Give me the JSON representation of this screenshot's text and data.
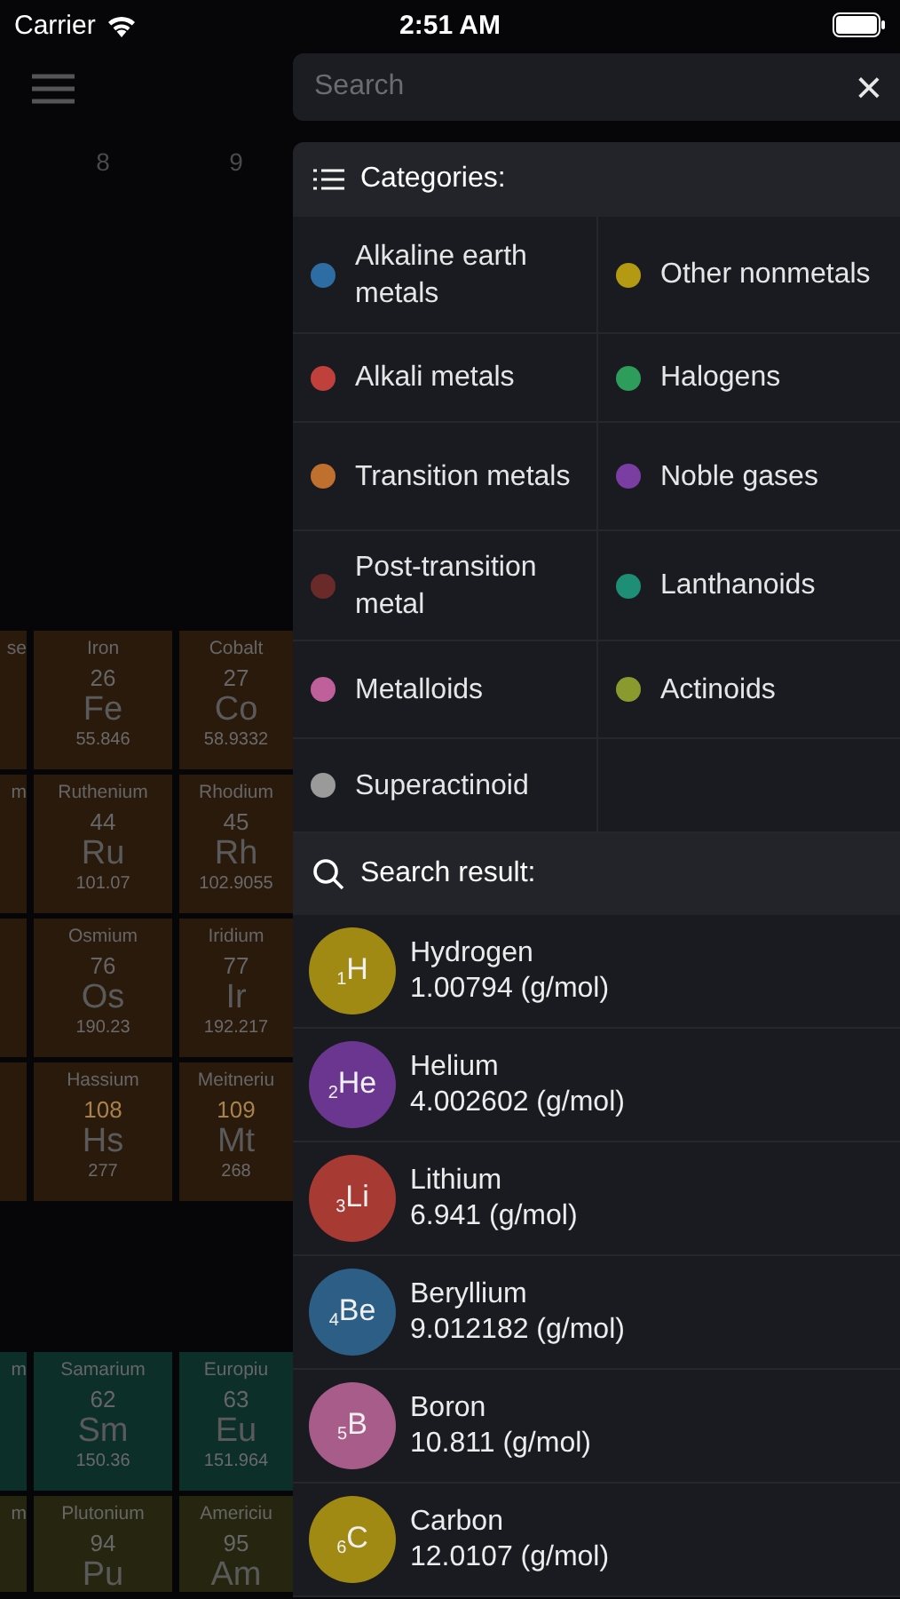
{
  "status_bar": {
    "carrier": "Carrier",
    "time": "2:51 AM"
  },
  "table": {
    "group_numbers": [
      "8",
      "9"
    ],
    "blocks": [
      {
        "rows": [
          [
            {
              "name": "se",
              "color": "#2a1a0c"
            },
            {
              "name": "Iron",
              "number": "26",
              "symbol": "Fe",
              "weight": "55.846",
              "synthetic": false,
              "color": "#2a1a0c"
            },
            {
              "name": "Cobalt",
              "number": "27",
              "symbol": "Co",
              "weight": "58.9332",
              "synthetic": false,
              "color": "#2a1a0c"
            }
          ],
          [
            {
              "name": "m",
              "color": "#2a1a0c"
            },
            {
              "name": "Ruthenium",
              "number": "44",
              "symbol": "Ru",
              "weight": "101.07",
              "synthetic": false,
              "color": "#2a1a0c"
            },
            {
              "name": "Rhodium",
              "number": "45",
              "symbol": "Rh",
              "weight": "102.9055",
              "synthetic": false,
              "color": "#2a1a0c"
            }
          ],
          [
            {
              "color": "#2a1a0c"
            },
            {
              "name": "Osmium",
              "number": "76",
              "symbol": "Os",
              "weight": "190.23",
              "synthetic": false,
              "color": "#2a1a0c"
            },
            {
              "name": "Iridium",
              "number": "77",
              "symbol": "Ir",
              "weight": "192.217",
              "synthetic": false,
              "color": "#2a1a0c"
            }
          ],
          [
            {
              "color": "#2a1a0c"
            },
            {
              "name": "Hassium",
              "number": "108",
              "symbol": "Hs",
              "weight": "277",
              "synthetic": true,
              "color": "#2a1a0c"
            },
            {
              "name": "Meitneriu",
              "number": "109",
              "symbol": "Mt",
              "weight": "268",
              "synthetic": true,
              "color": "#2a1a0c"
            }
          ]
        ]
      },
      {
        "rows": [
          [
            {
              "name": "m",
              "color": "#0c2f29"
            },
            {
              "name": "Samarium",
              "number": "62",
              "symbol": "Sm",
              "weight": "150.36",
              "synthetic": false,
              "color": "#0c2f29"
            },
            {
              "name": "Europiu",
              "number": "63",
              "symbol": "Eu",
              "weight": "151.964",
              "synthetic": false,
              "color": "#0c2f29"
            }
          ],
          [
            {
              "name": "m",
              "color": "#262610"
            },
            {
              "name": "Plutonium",
              "number": "94",
              "symbol": "Pu",
              "synthetic": false,
              "color": "#262610"
            },
            {
              "name": "Americiu",
              "number": "95",
              "symbol": "Am",
              "synthetic": false,
              "color": "#262610"
            }
          ]
        ]
      }
    ]
  },
  "search": {
    "placeholder": "Search",
    "clear": "×"
  },
  "categories": {
    "title": "Categories:",
    "items": [
      {
        "label": "Alkaline earth metals",
        "color": "#2e6da4"
      },
      {
        "label": "Other nonmetals",
        "color": "#b49a12"
      },
      {
        "label": "Alkali metals",
        "color": "#c0403b"
      },
      {
        "label": "Halogens",
        "color": "#2e9c5a"
      },
      {
        "label": "Transition metals",
        "color": "#c0702e"
      },
      {
        "label": "Noble gases",
        "color": "#7a3ea2"
      },
      {
        "label": "Post-transition metal",
        "color": "#6a2a2a"
      },
      {
        "label": "Lanthanoids",
        "color": "#1e8e77"
      },
      {
        "label": "Metalloids",
        "color": "#c0609a"
      },
      {
        "label": "Actinoids",
        "color": "#8a9a2e"
      },
      {
        "label": "Superactinoid",
        "color": "#9a9a9a"
      }
    ]
  },
  "results": {
    "title": "Search result:",
    "items": [
      {
        "symbol": "$_{1}$H",
        "name": "Hydrogen",
        "mass": "1.00794 (g/mol)",
        "color": "#a08a14"
      },
      {
        "symbol": "$_{2}$He",
        "name": "Helium",
        "mass": "4.002602 (g/mol)",
        "color": "#6a3690"
      },
      {
        "symbol": "$_{3}$Li",
        "name": "Lithium",
        "mass": "6.941 (g/mol)",
        "color": "#a83a34"
      },
      {
        "symbol": "$_{4}$Be",
        "name": "Beryllium",
        "mass": "9.012182 (g/mol)",
        "color": "#2d5f86"
      },
      {
        "symbol": "$_{5}$B",
        "name": "Boron",
        "mass": "10.811 (g/mol)",
        "color": "#a85c8a"
      },
      {
        "symbol": "$_{6}$C",
        "name": "Carbon",
        "mass": "12.0107 (g/mol)",
        "color": "#a08a14"
      }
    ]
  }
}
